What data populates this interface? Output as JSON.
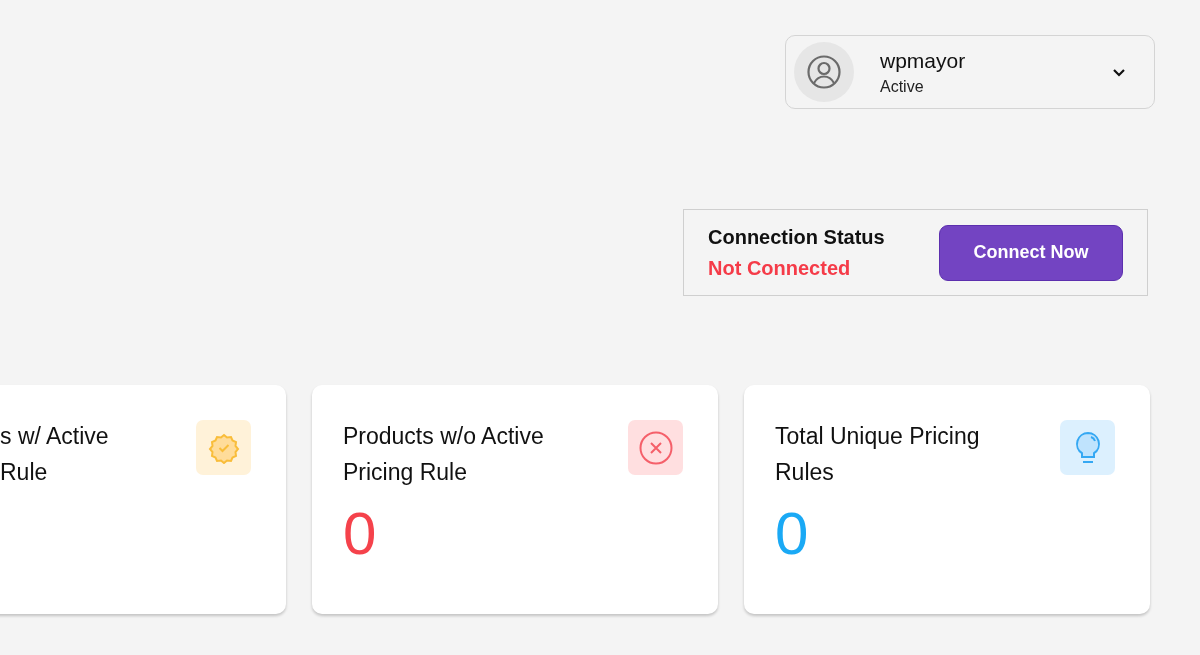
{
  "user_menu": {
    "name": "wpmayor",
    "status": "Active",
    "expanded": false
  },
  "connection": {
    "label": "Connection Status",
    "status": "Not Connected",
    "connected": false,
    "button": "Connect Now"
  },
  "cards": [
    {
      "kind": "success",
      "cut_left": true,
      "title_lines": [
        "s w/ Active",
        "Rule"
      ]
    },
    {
      "kind": "danger",
      "title_lines": [
        "Products w/o Active",
        "Pricing Rule"
      ],
      "value": "0",
      "color": "#f5424b"
    },
    {
      "kind": "info",
      "title_lines": [
        "Total Unique Pricing",
        "Rules"
      ],
      "value": "0",
      "color": "#1aa9f5"
    }
  ]
}
